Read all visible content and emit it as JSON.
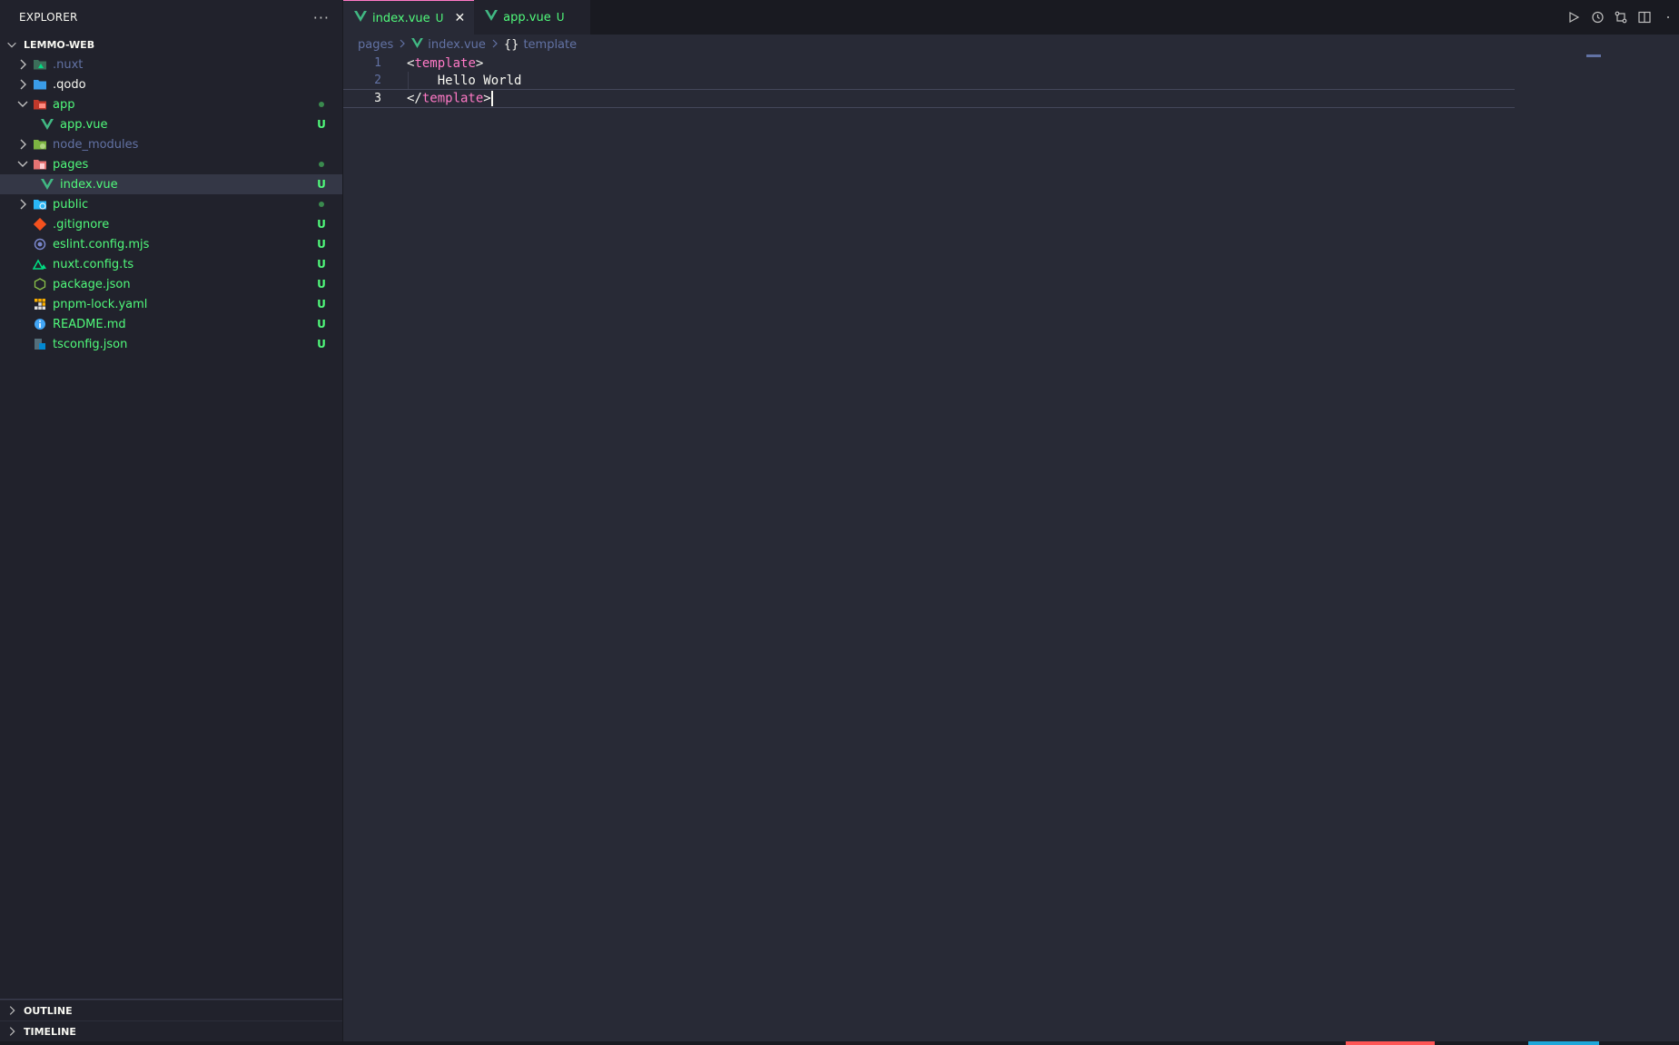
{
  "explorer": {
    "title": "EXPLORER",
    "more": "···",
    "root": "LEMMO-WEB",
    "items": [
      {
        "name": ".nuxt",
        "kind": "folder",
        "expanded": false,
        "style": "dim",
        "status": ""
      },
      {
        "name": ".qodo",
        "kind": "folder",
        "expanded": false,
        "style": "normal",
        "status": ""
      },
      {
        "name": "app",
        "kind": "folder",
        "expanded": true,
        "style": "green",
        "status": "dot"
      },
      {
        "name": "app.vue",
        "kind": "file",
        "style": "green",
        "status": "U"
      },
      {
        "name": "node_modules",
        "kind": "folder",
        "expanded": false,
        "style": "dim",
        "status": ""
      },
      {
        "name": "pages",
        "kind": "folder",
        "expanded": true,
        "style": "green",
        "status": "dot"
      },
      {
        "name": "index.vue",
        "kind": "file",
        "style": "green",
        "status": "U"
      },
      {
        "name": "public",
        "kind": "folder",
        "expanded": false,
        "style": "green",
        "status": "dot"
      },
      {
        "name": ".gitignore",
        "kind": "file",
        "style": "green",
        "status": "U"
      },
      {
        "name": "eslint.config.mjs",
        "kind": "file",
        "style": "green",
        "status": "U"
      },
      {
        "name": "nuxt.config.ts",
        "kind": "file",
        "style": "green",
        "status": "U"
      },
      {
        "name": "package.json",
        "kind": "file",
        "style": "green",
        "status": "U"
      },
      {
        "name": "pnpm-lock.yaml",
        "kind": "file",
        "style": "green",
        "status": "U"
      },
      {
        "name": "README.md",
        "kind": "file",
        "style": "green",
        "status": "U"
      },
      {
        "name": "tsconfig.json",
        "kind": "file",
        "style": "green",
        "status": "U"
      }
    ],
    "outline": "OUTLINE",
    "timeline": "TIMELINE"
  },
  "tabs": [
    {
      "label": "index.vue",
      "status": "U",
      "active": true,
      "close": "✕"
    },
    {
      "label": "app.vue",
      "status": "U",
      "active": false
    }
  ],
  "breadcrumb": {
    "folder": "pages",
    "file": "index.vue",
    "symbol_icon": "{}",
    "symbol": "template"
  },
  "editor": {
    "lines": [
      {
        "n": "1",
        "open": "<",
        "tag": "template",
        "close": ">",
        "indent": ""
      },
      {
        "n": "2",
        "text": "Hello World",
        "indent": "    "
      },
      {
        "n": "3",
        "open": "</",
        "tag": "template",
        "close": ">",
        "indent": ""
      }
    ]
  },
  "colors": {
    "accent_pink": "#ff79c6",
    "git_green": "#50fa7b",
    "comment": "#6272a4",
    "error_red": "#ff5555",
    "status_blue": "#1ea7d9"
  }
}
